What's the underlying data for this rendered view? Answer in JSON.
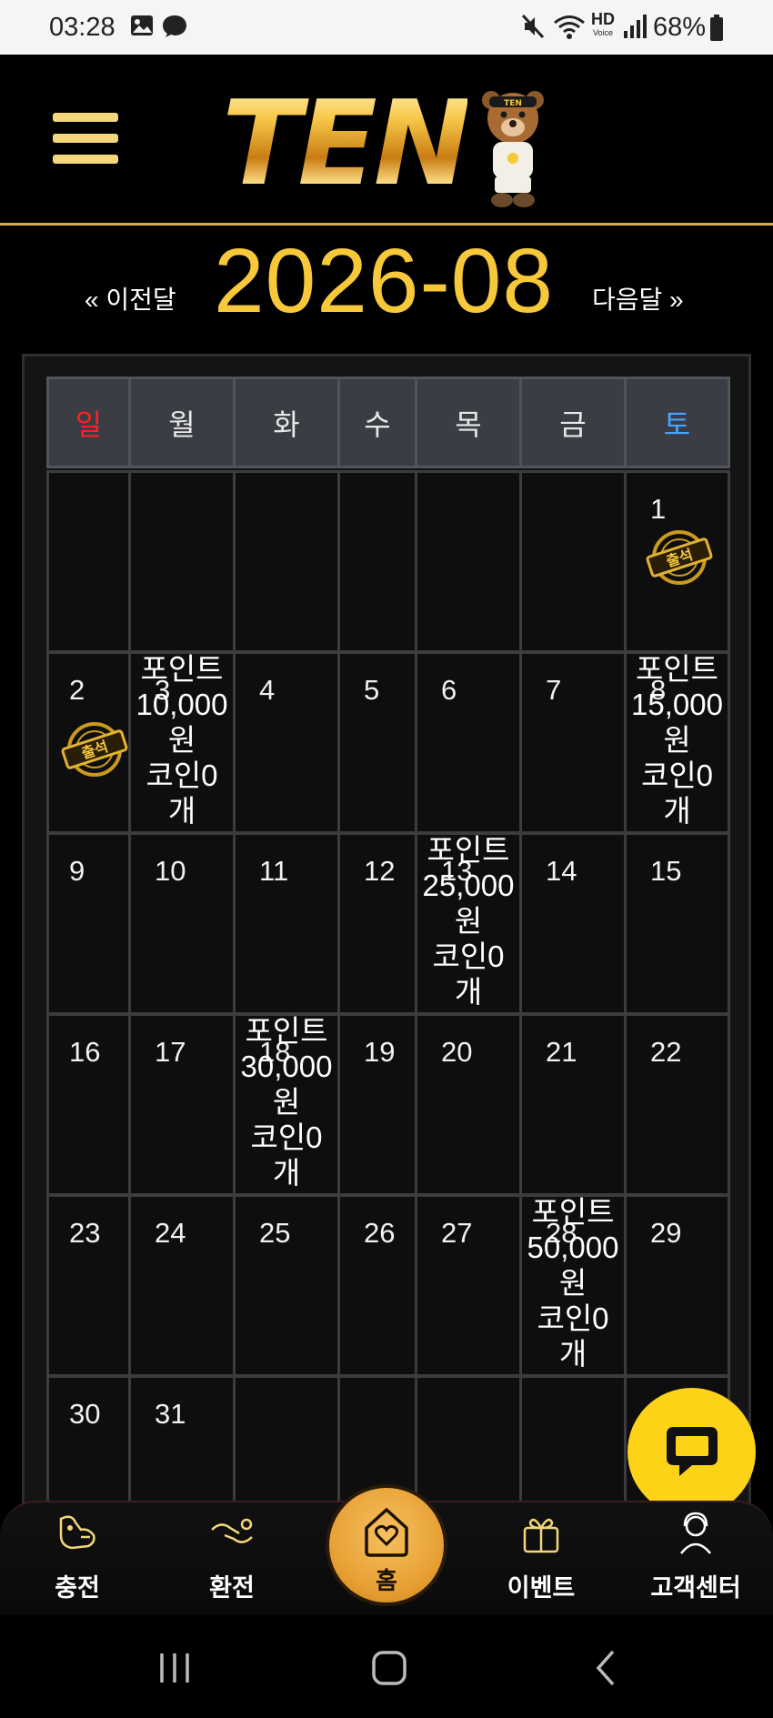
{
  "status_bar": {
    "time": "03:28",
    "battery": "68%",
    "hd_label": "HD",
    "voice_label": "Voice"
  },
  "header": {
    "logo_text": "TEN",
    "logo_badge": "TEN",
    "colors": {
      "gold": "#f6c83a",
      "border": "#d7ae4c"
    }
  },
  "month_nav": {
    "prev_label": "« 이전달",
    "title": "2026-08",
    "next_label": "다음달 »"
  },
  "calendar": {
    "weekdays": [
      "일",
      "월",
      "화",
      "수",
      "목",
      "금",
      "토"
    ],
    "weekday_colors": {
      "sun": "#ff2020",
      "sat": "#4aa3ff"
    },
    "stamp_label": "출석",
    "weeks": [
      [
        "",
        "",
        "",
        "",
        "",
        "",
        "1"
      ],
      [
        "2",
        "3",
        "4",
        "5",
        "6",
        "7",
        "8"
      ],
      [
        "9",
        "10",
        "11",
        "12",
        "13",
        "14",
        "15"
      ],
      [
        "16",
        "17",
        "18",
        "19",
        "20",
        "21",
        "22"
      ],
      [
        "23",
        "24",
        "25",
        "26",
        "27",
        "28",
        "29"
      ],
      [
        "30",
        "31",
        "",
        "",
        "",
        "",
        ""
      ]
    ],
    "attendance_days": [
      "1",
      "2"
    ],
    "rewards": [
      {
        "day": "3",
        "lines": [
          "포인트",
          "10,000",
          "원",
          "코인0",
          "개"
        ]
      },
      {
        "day": "8",
        "lines": [
          "포인트",
          "15,000",
          "원",
          "코인0",
          "개"
        ]
      },
      {
        "day": "13",
        "lines": [
          "포인트",
          "25,000",
          "원",
          "코인0",
          "개"
        ]
      },
      {
        "day": "18",
        "lines": [
          "포인트",
          "30,000",
          "원",
          "코인0",
          "개"
        ]
      },
      {
        "day": "28",
        "lines": [
          "포인트",
          "50,000",
          "원",
          "코인0",
          "개"
        ]
      }
    ]
  },
  "bottom_nav": {
    "items": [
      {
        "label": "충전",
        "icon": "charge-icon"
      },
      {
        "label": "환전",
        "icon": "exchange-icon"
      },
      {
        "label": "홈",
        "icon": "home-heart-icon"
      },
      {
        "label": "이벤트",
        "icon": "gift-icon"
      },
      {
        "label": "고객센터",
        "icon": "support-icon"
      }
    ],
    "accent": "#e8a236"
  },
  "chat_button": {
    "icon": "chat-bubble-icon",
    "color": "#fdd318"
  }
}
